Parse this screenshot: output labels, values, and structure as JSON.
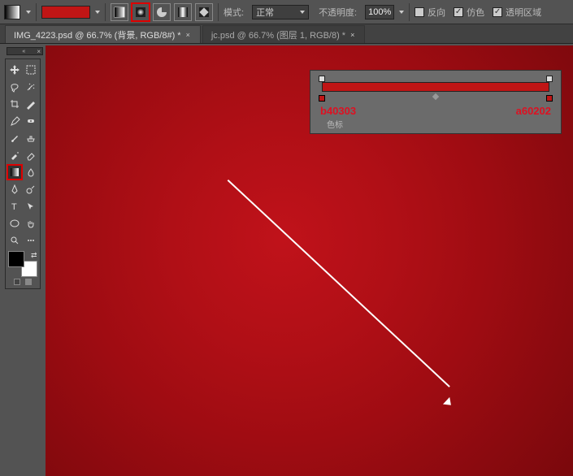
{
  "options_bar": {
    "gradient_icon": "gradient-tool-icon",
    "gradient_swatch_color": "#c01515",
    "style_linear": "linear-gradient-icon",
    "style_radial": "radial-gradient-icon",
    "style_angle": "angle-gradient-icon",
    "style_reflected": "reflected-gradient-icon",
    "style_diamond": "diamond-gradient-icon",
    "mode_label": "模式:",
    "mode_value": "正常",
    "opacity_label": "不透明度:",
    "opacity_value": "100%",
    "reverse_label": "反向",
    "reverse_checked": false,
    "dither_label": "仿色",
    "dither_checked": true,
    "transparency_label": "透明区域",
    "transparency_checked": true
  },
  "tabs": [
    {
      "label": "IMG_4223.psd @ 66.7% (背景, RGB/8#) *",
      "active": true
    },
    {
      "label": "jc.psd @ 66.7% (图层 1, RGB/8) *",
      "active": false
    }
  ],
  "toolbox": {
    "rows": [
      [
        "move-tool",
        "rect-marquee-tool"
      ],
      [
        "lasso-tool",
        "magic-wand-tool"
      ],
      [
        "crop-tool",
        "slice-tool"
      ],
      [
        "eyedropper-tool",
        "healing-brush-tool"
      ],
      [
        "brush-tool",
        "clone-stamp-tool"
      ],
      [
        "history-brush-tool",
        "eraser-tool"
      ],
      [
        "gradient-tool",
        "blur-tool"
      ],
      [
        "pen-tool",
        "type-tool"
      ],
      [
        "path-select-tool",
        "rectangle-tool"
      ],
      [
        "hand-tool",
        "zoom-tool"
      ]
    ],
    "selected": "gradient-tool",
    "foreground": "#000000",
    "background": "#ffffff"
  },
  "gradient_editor": {
    "bar_start_color": "#c01515",
    "bar_end_color": "#c01515",
    "left_stop_label": "b40303",
    "right_stop_label": "a60202",
    "hint": "色标"
  }
}
